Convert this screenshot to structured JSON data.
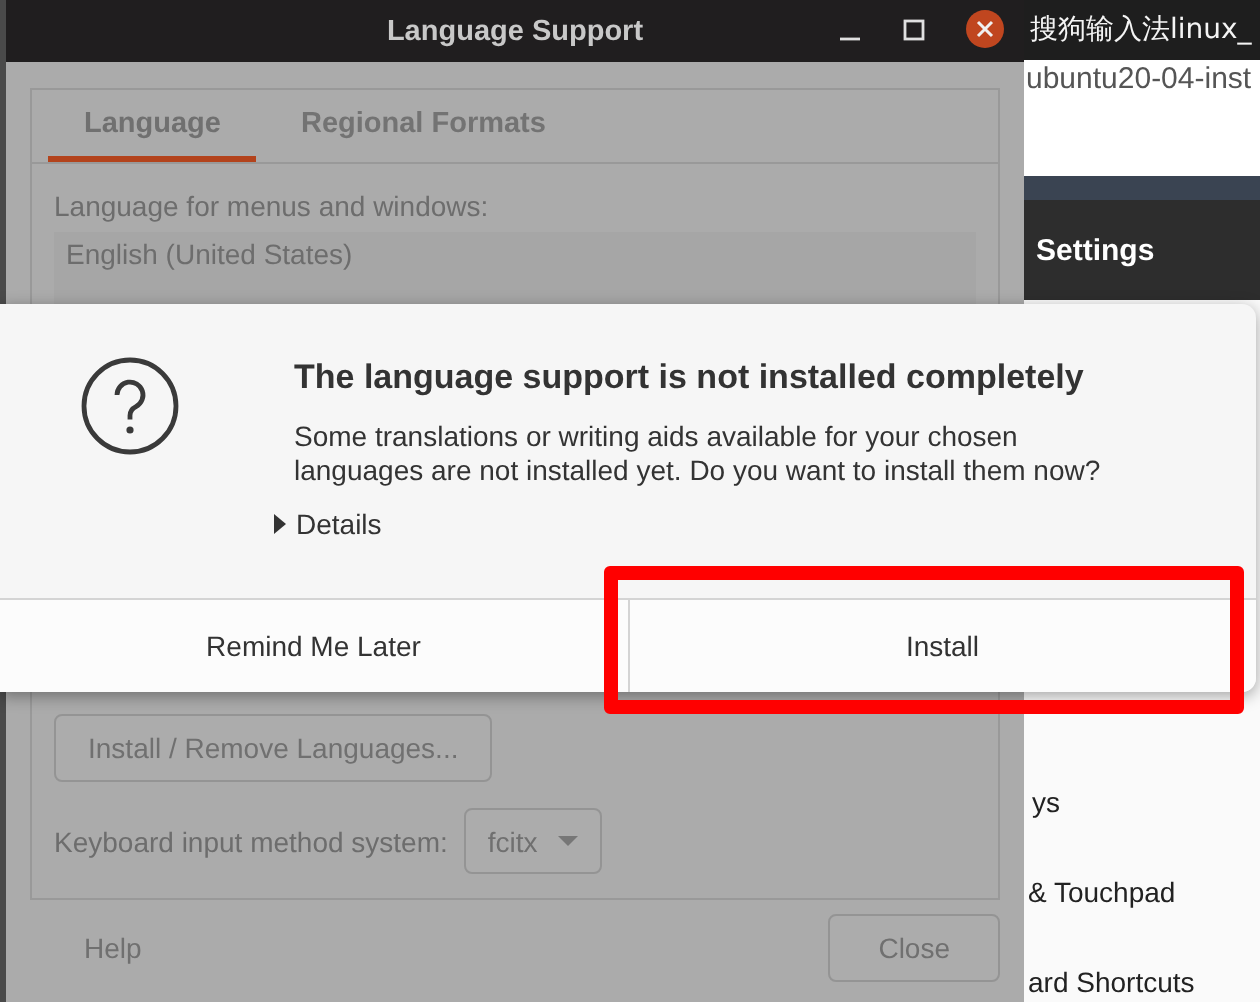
{
  "background_window": {
    "tab_title": "搜狗输入法linux_",
    "address": "ubuntu20-04-inst",
    "header_title": "Settings",
    "sidebar_items": [
      "ys",
      "& Touchpad",
      "ard Shortcuts"
    ]
  },
  "window": {
    "title": "Language Support"
  },
  "tabs": [
    {
      "label": "Language",
      "selected": true
    },
    {
      "label": "Regional Formats",
      "selected": false
    }
  ],
  "language_list": {
    "label": "Language for menus and windows:",
    "items": [
      "English (United States)"
    ]
  },
  "install_remove_button": "Install / Remove Languages...",
  "input_method": {
    "label": "Keyboard input method system:",
    "value": "fcitx"
  },
  "footer_buttons": [
    {
      "label": "Help",
      "kind": "flat"
    },
    {
      "label": "Close",
      "kind": "bordered"
    }
  ],
  "dialog": {
    "title": "The language support is not installed completely",
    "message": "Some translations or writing aids available for your chosen languages are not installed yet. Do you want to install them now?",
    "details": {
      "label": "Details",
      "expanded": false
    },
    "buttons": [
      {
        "label": "Remind Me Later",
        "highlighted": false
      },
      {
        "label": "Install",
        "highlighted": true
      }
    ]
  }
}
